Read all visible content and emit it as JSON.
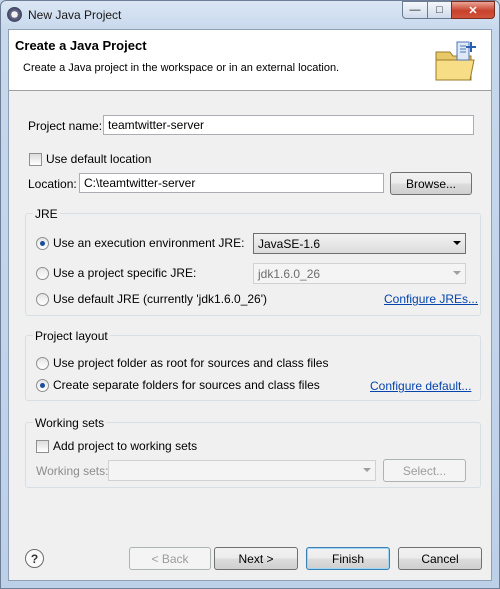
{
  "window": {
    "title": "New Java Project",
    "min_glyph": "—",
    "max_glyph": "□",
    "close_glyph": "✕"
  },
  "banner": {
    "title": "Create a Java Project",
    "description": "Create a Java project in the workspace or in an external location."
  },
  "project": {
    "name_label": "Project name:",
    "name_value": "teamtwitter-server"
  },
  "location": {
    "use_default_label": "Use default location",
    "use_default_checked": false,
    "label": "Location:",
    "value": "C:\\teamtwitter-server",
    "browse_label": "Browse..."
  },
  "jre": {
    "group_title": "JRE",
    "option_env_label": "Use an execution environment JRE:",
    "env_value": "JavaSE-1.6",
    "option_specific_label": "Use a project specific JRE:",
    "specific_value": "jdk1.6.0_26",
    "option_default_label": "Use default JRE (currently 'jdk1.6.0_26')",
    "configure_link": "Configure JREs...",
    "selected": "env"
  },
  "layout": {
    "group_title": "Project layout",
    "option_root_label": "Use project folder as root for sources and class files",
    "option_separate_label": "Create separate folders for sources and class files",
    "configure_link": "Configure default...",
    "selected": "separate"
  },
  "working_sets": {
    "group_title": "Working sets",
    "add_label": "Add project to working sets",
    "add_checked": false,
    "sets_label": "Working sets:",
    "sets_value": "",
    "select_label": "Select..."
  },
  "footer": {
    "help_glyph": "?",
    "back_label": "< Back",
    "next_label": "Next >",
    "finish_label": "Finish",
    "cancel_label": "Cancel"
  },
  "colors": {
    "link": "#0645ad",
    "title_bar": "#c4d5ea",
    "close_button": "#c8412c"
  }
}
